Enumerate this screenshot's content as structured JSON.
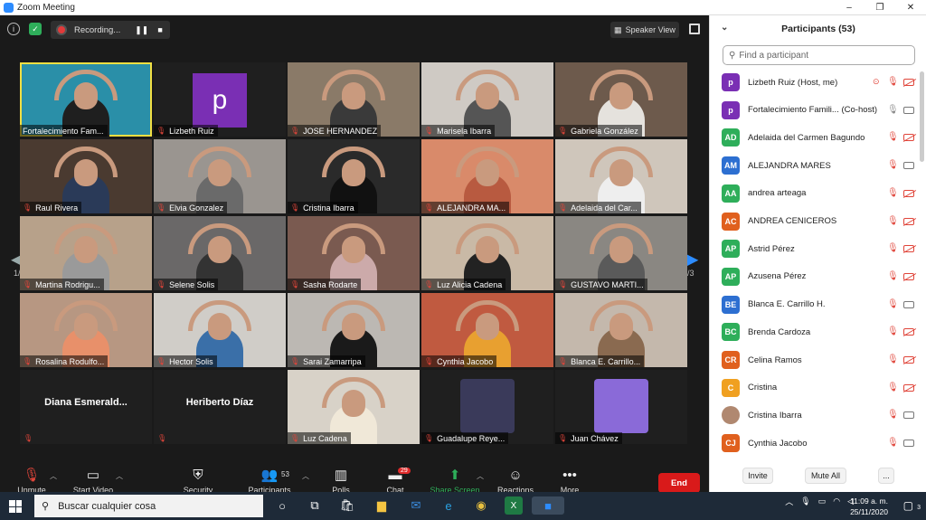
{
  "window": {
    "title": "Zoom Meeting",
    "minimize": "–",
    "maximize": "❐",
    "close": "✕"
  },
  "topbar": {
    "info_icon": "i",
    "shield_icon": "✓",
    "recording_label": "Recording...",
    "pause": "❚❚",
    "stop": "■",
    "speaker_view_label": "Speaker View"
  },
  "gallery": {
    "page_left": "1/3",
    "page_right": "1/3",
    "tiles": [
      {
        "name": "Fortalecimiento Fam...",
        "muted": false,
        "kind": "video",
        "bg": "#2a8fa8",
        "shirt": "#1f1f1f",
        "active": true
      },
      {
        "name": "Lizbeth Ruiz",
        "muted": true,
        "kind": "avatar",
        "letter": "p"
      },
      {
        "name": "JOSE HERNANDEZ",
        "muted": true,
        "kind": "video",
        "bg": "#8a7a68",
        "shirt": "#3a3a3a"
      },
      {
        "name": "Marisela Ibarra",
        "muted": true,
        "kind": "video",
        "bg": "#cfcac4",
        "shirt": "#555"
      },
      {
        "name": "Gabriela González",
        "muted": true,
        "kind": "video",
        "bg": "#6d5a4c",
        "shirt": "#e5e2dd"
      },
      {
        "name": "Raul Rivera",
        "muted": true,
        "kind": "video",
        "bg": "#4a3a30",
        "shirt": "#2a3a58"
      },
      {
        "name": "Elvia Gonzalez",
        "muted": true,
        "kind": "video",
        "bg": "#9a9590",
        "shirt": "#6a6a6a"
      },
      {
        "name": "Cristina Ibarra",
        "muted": true,
        "kind": "video",
        "bg": "#2a2a2a",
        "shirt": "#111"
      },
      {
        "name": "ALEJANDRA MA...",
        "muted": true,
        "kind": "video",
        "bg": "#d98a6a",
        "shirt": "#b85a40"
      },
      {
        "name": "Adelaida del Car...",
        "muted": true,
        "kind": "video",
        "bg": "#cfc6bb",
        "shirt": "#eee"
      },
      {
        "name": "Martina Rodrigu...",
        "muted": true,
        "kind": "video",
        "bg": "#b7a18a",
        "shirt": "#9a9a9a"
      },
      {
        "name": "Selene Solis",
        "muted": true,
        "kind": "video",
        "bg": "#6a6868",
        "shirt": "#333"
      },
      {
        "name": "Sasha Rodarte",
        "muted": true,
        "kind": "video",
        "bg": "#7a5a50",
        "shirt": "#caa"
      },
      {
        "name": "Luz Alicia Cadena",
        "muted": true,
        "kind": "video",
        "bg": "#c9b9a6",
        "shirt": "#222"
      },
      {
        "name": "GUSTAVO MARTI...",
        "muted": true,
        "kind": "video",
        "bg": "#8a8782",
        "shirt": "#5a5a5a"
      },
      {
        "name": "Rosalina Rodulfo...",
        "muted": true,
        "kind": "video",
        "bg": "#b79782",
        "shirt": "#e8906a"
      },
      {
        "name": "Hector Solis",
        "muted": true,
        "kind": "video",
        "bg": "#d0cdc8",
        "shirt": "#3a6fa8"
      },
      {
        "name": "Sarai Zamarripa",
        "muted": true,
        "kind": "video",
        "bg": "#bcb8b3",
        "shirt": "#1a1a1a"
      },
      {
        "name": "Cynthia Jacobo",
        "muted": true,
        "kind": "video",
        "bg": "#c05a40",
        "shirt": "#e8a030"
      },
      {
        "name": "Blanca E. Carrillo...",
        "muted": true,
        "kind": "video",
        "bg": "#c4b8ac",
        "shirt": "#8a6a50"
      },
      {
        "name": "Diana  Esmerald...",
        "muted": true,
        "kind": "text"
      },
      {
        "name": "Heriberto Díaz",
        "muted": true,
        "kind": "text"
      },
      {
        "name": "Luz Cadena",
        "muted": true,
        "kind": "video",
        "bg": "#d8d2c8",
        "shirt": "#f0e8d8"
      },
      {
        "name": "Guadalupe Reye...",
        "muted": true,
        "kind": "picture",
        "pic": "#3a3a5a"
      },
      {
        "name": "Juan Chávez",
        "muted": true,
        "kind": "picture",
        "pic": "#8a6ad8"
      }
    ]
  },
  "toolbar": {
    "unmute": "Unmute",
    "start_video": "Start Video",
    "security": "Security",
    "participants": "Participants",
    "participants_count": "53",
    "polls": "Polls",
    "chat": "Chat",
    "chat_badge": "29",
    "share_screen": "Share Screen",
    "reactions": "Reactions",
    "more": "More",
    "end": "End"
  },
  "panel": {
    "title": "Participants (53)",
    "search_placeholder": "Find a participant",
    "participants": [
      {
        "initials": "p",
        "name": "Lizbeth Ruiz (Host, me)",
        "color": "#7a2fb4",
        "rec": true,
        "mic": "muted",
        "cam": "off"
      },
      {
        "initials": "p",
        "name": "Fortalecimiento Famili... (Co-host)",
        "color": "#7a2fb4",
        "rec": false,
        "mic": "on",
        "cam": "on"
      },
      {
        "initials": "AD",
        "name": "Adelaida del Carmen Bagundo",
        "color": "#2eae5a",
        "rec": false,
        "mic": "muted",
        "cam": "off"
      },
      {
        "initials": "AM",
        "name": "ALEJANDRA MARES",
        "color": "#2d6fd1",
        "rec": false,
        "mic": "muted",
        "cam": "on"
      },
      {
        "initials": "AA",
        "name": "andrea arteaga",
        "color": "#2eae5a",
        "rec": false,
        "mic": "muted",
        "cam": "off"
      },
      {
        "initials": "AC",
        "name": "ANDREA CENICEROS",
        "color": "#e0601e",
        "rec": false,
        "mic": "muted",
        "cam": "off"
      },
      {
        "initials": "AP",
        "name": "Astrid Pérez",
        "color": "#2eae5a",
        "rec": false,
        "mic": "muted",
        "cam": "off"
      },
      {
        "initials": "AP",
        "name": "Azusena Pérez",
        "color": "#2eae5a",
        "rec": false,
        "mic": "muted",
        "cam": "off"
      },
      {
        "initials": "BE",
        "name": "Blanca E. Carrillo H.",
        "color": "#2d6fd1",
        "rec": false,
        "mic": "muted",
        "cam": "on"
      },
      {
        "initials": "BC",
        "name": "Brenda Cardoza",
        "color": "#2eae5a",
        "rec": false,
        "mic": "muted",
        "cam": "off"
      },
      {
        "initials": "CR",
        "name": "Celina Ramos",
        "color": "#e0601e",
        "rec": false,
        "mic": "muted",
        "cam": "off"
      },
      {
        "initials": "C",
        "name": "Cristina",
        "color": "#f0a020",
        "rec": false,
        "mic": "muted",
        "cam": "off"
      },
      {
        "initials": "",
        "name": "Cristina Ibarra",
        "color": "#b08870",
        "rec": false,
        "mic": "muted",
        "cam": "on"
      },
      {
        "initials": "CJ",
        "name": "Cynthia Jacobo",
        "color": "#e0601e",
        "rec": false,
        "mic": "muted",
        "cam": "on"
      }
    ],
    "invite": "Invite",
    "mute_all": "Mute All",
    "more": "..."
  },
  "taskbar": {
    "search_placeholder": "Buscar cualquier cosa",
    "time": "11:09 a. m.",
    "date": "25/11/2020",
    "notifications": "3"
  }
}
